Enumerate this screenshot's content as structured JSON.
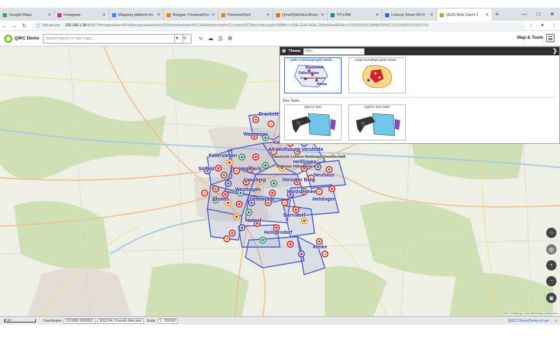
{
  "browser": {
    "tabs": [
      {
        "title": "Google Maps",
        "color": "#34a853"
      },
      {
        "title": "Instagram",
        "color": "#c13584"
      },
      {
        "title": "Mapping platform for",
        "color": "#4285f4"
      },
      {
        "title": "Blogger: ParanoiaTech",
        "color": "#f57d00"
      },
      {
        "title": "ParanoiaTech",
        "color": "#f57d00"
      },
      {
        "title": "Qmo0QtbGhizUlkuno",
        "color": "#e8710a"
      },
      {
        "title": "TP-LINK",
        "color": "#1b8b8b"
      },
      {
        "title": "Linksys Smart Wi-Fi",
        "color": "#2a6bd6"
      },
      {
        "title": "QGIS Web Client 2",
        "color": "#8bbb3c",
        "active": true
      }
    ],
    "new_tab": "+",
    "address": {
      "security": "Not secure",
      "host": "192.168.1.38",
      "path": ":8081/?bl=mapnik&st=&l=Hilfsorganisationen%2CBushaltestellen%2CAbfallwirtschaft%2CLinien%2CBeschriftung&t=09f9ffc0-c6d6-11e6-b65a-2fb8a84ee860&c=1150365%2C6848629%2C1251965%2C6901916"
    }
  },
  "app": {
    "logo_text": "QWC Demo",
    "search_placeholder": "Search places or add maps...",
    "map_tools_label": "Map & Tools"
  },
  "theme_panel": {
    "title": "Theme",
    "filter_placeholder": "Filter...",
    "themes": [
      {
        "title": "QWC II Demoprojekt Stadt ...",
        "selected": true
      },
      {
        "title": "Liegenschaftsprojekte Stadt ..."
      }
    ],
    "group_title": "Dev Tests",
    "dev_themes": [
      {
        "title": "QWC2 Test"
      },
      {
        "title": "QWC2 Test 2056"
      }
    ],
    "thumb1_labels": [
      "Brackstedt",
      "Fallersleben",
      "Technisches Hilfswerk",
      "Almke"
    ]
  },
  "map": {
    "places": [
      "Brackstedt",
      "Warmenau",
      "Kastorf",
      "Alt-Wolfsburg Vorsfelde",
      "Fallersleben",
      "Deutsche Lebens-Rettungs-Gesellschaft",
      "Heßlingen",
      "Malteser Hilfsdienst e.V.",
      "Sülfeld",
      "Hageberg",
      "Neuhaus",
      "Laagberg",
      "Steimker Berg",
      "Westhagen",
      "Nordsteimke",
      "Ehmen",
      "Detmerode",
      "Hehlingen",
      "Barnstorf",
      "Hattorf",
      "Heiligendorf",
      "Almke"
    ],
    "attribution": "Tiles: Wolfsburg | OpenStreetMap contributors"
  },
  "status": {
    "scale_bar": "5 km",
    "coordinates_label": "Coordinates",
    "coordinates_value": "1153689 6868321",
    "crs_value": "WGS 84 / Pseudo Mercator",
    "scale_label": "Scale",
    "scale_value": "1 : 206000",
    "right_text": "QWC2 Demo|Terms of use"
  }
}
